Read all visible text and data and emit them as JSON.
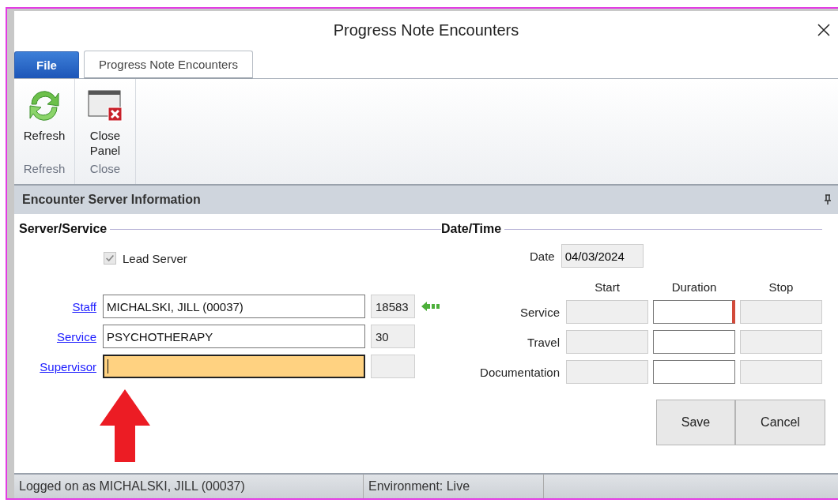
{
  "window": {
    "title": "Progress Note Encounters"
  },
  "tabs": [
    {
      "label": "File",
      "kind": "file",
      "selected": false
    },
    {
      "label": "Progress Note Encounters",
      "kind": "ribbon",
      "selected": true
    }
  ],
  "ribbon_groups": [
    {
      "label": "Refresh",
      "button": {
        "label": "Refresh",
        "kind": "refresh"
      }
    },
    {
      "label": "Close",
      "button": {
        "label": "Close Panel",
        "kind": "close-panel"
      }
    }
  ],
  "panel": {
    "title": "Encounter Server Information"
  },
  "server_service": {
    "title": "Server/Service",
    "lead_server": {
      "label": "Lead Server",
      "checked": true,
      "disabled": true
    },
    "fields": [
      {
        "label": "Staff",
        "value": "MICHALSKI, JILL (00037)",
        "code": "18583",
        "focused": false,
        "has_arrow": true
      },
      {
        "label": "Service",
        "value": "PSYCHOTHERAPY",
        "code": "30",
        "focused": false,
        "has_arrow": false
      },
      {
        "label": "Supervisor",
        "focused": true,
        "has_arrow": false
      }
    ]
  },
  "date_time": {
    "title": "Date/Time",
    "date_label": "Date",
    "date": "04/03/2024",
    "columns": [
      "Start",
      "Duration",
      "Stop"
    ],
    "rows": [
      {
        "label": "Service",
        "required": true
      },
      {
        "label": "Travel",
        "required": false
      },
      {
        "label": "Documentation",
        "required": false
      }
    ]
  },
  "buttons": [
    "Save",
    "Cancel"
  ],
  "status_bar": [
    "Logged on as MICHALSKI, JILL (00037)",
    "Environment: Live"
  ]
}
